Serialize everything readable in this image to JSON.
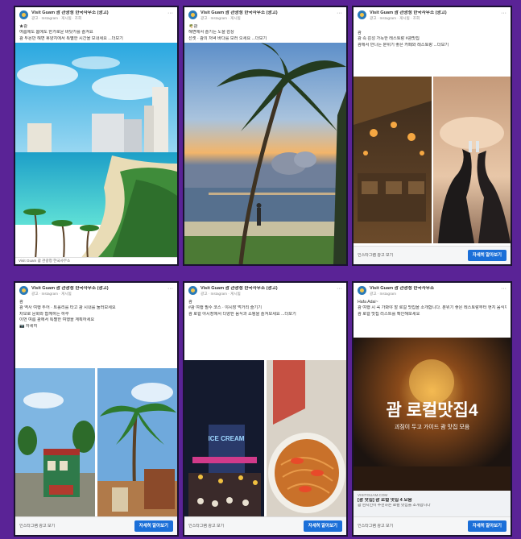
{
  "ads": [
    {
      "page_name": "Visit Guam 괌 관광청 한국사무소 (광고)",
      "meta": "광고 · Instagram · 게시됨 · 조회",
      "lines": [
        "★괌",
        "여름에도 봄에도 한가로운 바닷가를 즐겨요",
        "괌 투몬만 해변 휴양지에서 특별한 시간을 보내세요 ...더보기"
      ],
      "footer_label": "Visit Guam 괌 관광청 한국사무소"
    },
    {
      "page_name": "Visit Guam 괌 관광청 한국사무소 (광고)",
      "meta": "광고 · Instagram · 게시됨",
      "lines": [
        "🌴괌",
        "해변에서 즐기는 노을 감상",
        "선셋 · 괌의 저녁 바다를 보러 오세요 ...더보기"
      ]
    },
    {
      "page_name": "Visit Guam 괌 관광청 한국사무소 (광고)",
      "meta": "광고 · Instagram · 게시됨 · 조회",
      "lines": [
        "괌",
        "괌 속 감성 가득한 레스토랑 #괌맛집",
        "괌에서 만나는 분위기 좋은 카페와 레스토랑 ...더보기"
      ],
      "footer_label": "인스타그램 광고 보기",
      "cta": "자세히 알아보기"
    },
    {
      "page_name": "Visit Guam 괌 관광청 한국사무소 (광고)",
      "meta": "광고 · Instagram · 게시됨",
      "lines": [
        "괌",
        "괌 역사 여행 투어 · 트롤리를 타고 괌 시내를 둘러보세요",
        "차모로 문화와 함께하는 하루",
        "이번 여름 괌에서 특별한 여행을 계획하세요",
        "📷 자세히"
      ],
      "footer_label": "인스타그램 광고 보기",
      "cta": "자세히 알아보기"
    },
    {
      "page_name": "Visit Guam 괌 관광청 한국사무소 (광고)",
      "meta": "광고 · Instagram · 게시됨",
      "lines": [
        "괌",
        "#괌 여행 필수 코스 · 야시장 먹거리 즐기기",
        "괌 로컬 야시장에서 다양한 음식과 쇼핑을 즐겨보세요 ...더보기"
      ],
      "sign_text": "ICE CREAM",
      "footer_label": "인스타그램 광고 보기",
      "cta": "자세히 알아보기"
    },
    {
      "page_name": "Visit Guam 괌 관광청 한국사무소",
      "meta": "광고 · Instagram",
      "lines": [
        "Hafa Adai~",
        "괌 여행 시 꼭 가봐야 할 로컬 맛집을 소개합니다. 분위기 좋은 레스토랑부터 현지 음식까지",
        "괌 로컬 맛집 리스트를 확인해보세요"
      ],
      "overlay_title": "괌 로컬맛집4",
      "overlay_sub": "괴짐이 두고 가이드 괌 맛집 모음",
      "caption_site": "VISITGUAM.COM",
      "caption_title": "[괌 맛집] 괌 로컬 맛집 4 모음",
      "caption_desc": "괌 현지인이 추천하는 로컬 맛집을 소개합니다",
      "footer_label": "인스타그램 광고 보기",
      "cta": "자세히 알아보기"
    }
  ]
}
